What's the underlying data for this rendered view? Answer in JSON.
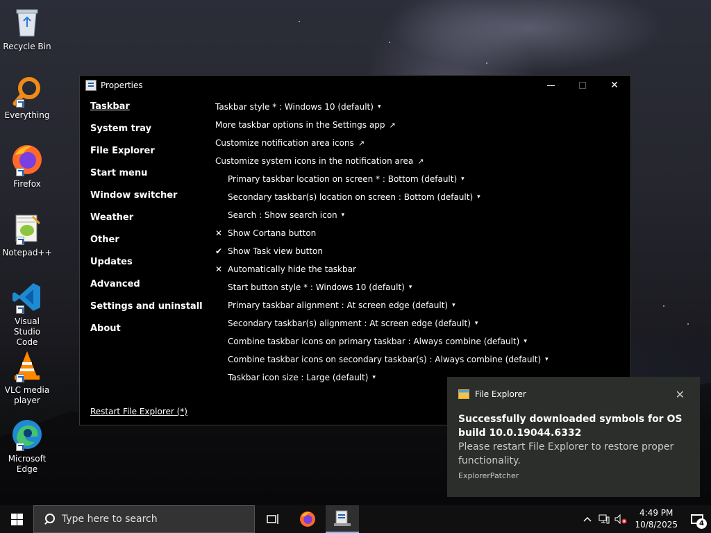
{
  "desktop": {
    "icons": [
      {
        "label": "Recycle Bin"
      },
      {
        "label": "Everything"
      },
      {
        "label": "Firefox"
      },
      {
        "label": "Notepad++"
      },
      {
        "label": "Visual Studio Code"
      },
      {
        "label": "VLC media player"
      },
      {
        "label": "Microsoft Edge"
      }
    ]
  },
  "window": {
    "title": "Properties",
    "minimize_icon": "minimize-icon",
    "maximize_icon": "maximize-icon",
    "close_glyph": "✕",
    "nav": [
      {
        "label": "Taskbar",
        "active": true
      },
      {
        "label": "System tray"
      },
      {
        "label": "File Explorer"
      },
      {
        "label": "Start menu"
      },
      {
        "label": "Window switcher"
      },
      {
        "label": "Weather"
      },
      {
        "label": "Other"
      },
      {
        "label": "Updates"
      },
      {
        "label": "Advanced"
      },
      {
        "label": "Settings and uninstall"
      },
      {
        "label": "About"
      }
    ],
    "restart_link": "Restart File Explorer (*)",
    "settings": [
      {
        "text": "Taskbar style * : Windows 10 (default)",
        "suffix": "▾"
      },
      {
        "text": "More taskbar options in the Settings app",
        "suffix": "↗"
      },
      {
        "text": "Customize notification area icons",
        "suffix": "↗"
      },
      {
        "text": "Customize system icons in the notification area",
        "suffix": "↗"
      },
      {
        "text": "Primary taskbar location on screen * : Bottom (default)",
        "suffix": "▾",
        "indent": true
      },
      {
        "text": "Secondary taskbar(s) location on screen : Bottom (default)",
        "suffix": "▾",
        "indent": true
      },
      {
        "text": "Search : Show search icon",
        "suffix": "▾",
        "indent": true
      },
      {
        "text": "Show Cortana button",
        "mark": "✕",
        "indent": true
      },
      {
        "text": "Show Task view button",
        "mark": "✔",
        "indent": true
      },
      {
        "text": "Automatically hide the taskbar",
        "mark": "✕",
        "indent": true
      },
      {
        "text": "Start button style * : Windows 10 (default)",
        "suffix": "▾",
        "indent": true
      },
      {
        "text": "Primary taskbar alignment : At screen edge (default)",
        "suffix": "▾",
        "indent": true
      },
      {
        "text": "Secondary taskbar(s) alignment : At screen edge (default)",
        "suffix": "▾",
        "indent": true
      },
      {
        "text": "Combine taskbar icons on primary taskbar : Always combine (default)",
        "suffix": "▾",
        "indent": true
      },
      {
        "text": "Combine taskbar icons on secondary taskbar(s) : Always combine (default)",
        "suffix": "▾",
        "indent": true
      },
      {
        "text": "Taskbar icon size : Large (default)",
        "suffix": "▾",
        "indent": true
      }
    ]
  },
  "toast": {
    "app": "File Explorer",
    "close_glyph": "✕",
    "title": "Successfully downloaded symbols for OS build 10.0.19044.6332",
    "body": "Please restart File Explorer to restore proper functionality.",
    "attribution": "ExplorerPatcher"
  },
  "taskbar": {
    "search_placeholder": "Type here to search",
    "time": "4:49 PM",
    "date": "10/8/2025",
    "notification_count": "4",
    "tray_icons": [
      "chevron-up-icon",
      "network-icon",
      "volume-muted-icon"
    ]
  }
}
